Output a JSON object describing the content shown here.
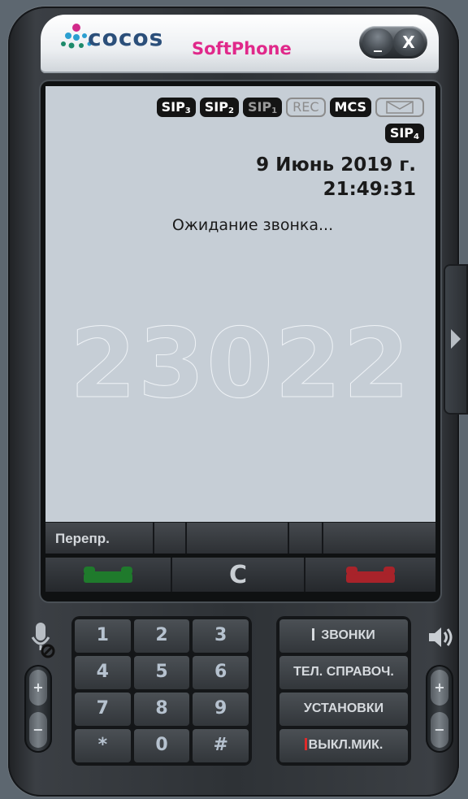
{
  "app": {
    "logo_word": "cocos",
    "logo_sub": "SoftPhone",
    "brand_colors": {
      "logo": "#2b4f7a",
      "sub": "#e0288a"
    },
    "window_buttons": {
      "minimize": "_",
      "close": "X"
    }
  },
  "screen": {
    "badges": [
      {
        "label": "SIP",
        "sub": "3",
        "style": "active"
      },
      {
        "label": "SIP",
        "sub": "2",
        "style": "active"
      },
      {
        "label": "SIP",
        "sub": "1",
        "style": "dim"
      },
      {
        "label": "REC",
        "sub": "",
        "style": "outline"
      },
      {
        "label": "MCS",
        "sub": "",
        "style": "active"
      }
    ],
    "envelope_icon": "envelope-icon",
    "sip4": {
      "label": "SIP",
      "sub": "4"
    },
    "date": "9 Июнь 2019 г.",
    "time": "21:49:31",
    "status": "Ожидание звонка...",
    "number": "23022"
  },
  "softkeys": [
    "Перепр.",
    "",
    "",
    "",
    ""
  ],
  "actions": {
    "call_icon": "green-handset-icon",
    "clear_label": "C",
    "hangup_icon": "red-handset-icon"
  },
  "keypad": [
    "1",
    "2",
    "3",
    "4",
    "5",
    "6",
    "7",
    "8",
    "9",
    "*",
    "0",
    "#"
  ],
  "menu": {
    "calls": "ЗВОНКИ",
    "directory": "ТЕЛ. СПРАВОЧ.",
    "settings": "УСТАНОВКИ",
    "mute_mic": "ВЫКЛ.МИК."
  },
  "rockers": {
    "up": "+",
    "down": "−"
  }
}
